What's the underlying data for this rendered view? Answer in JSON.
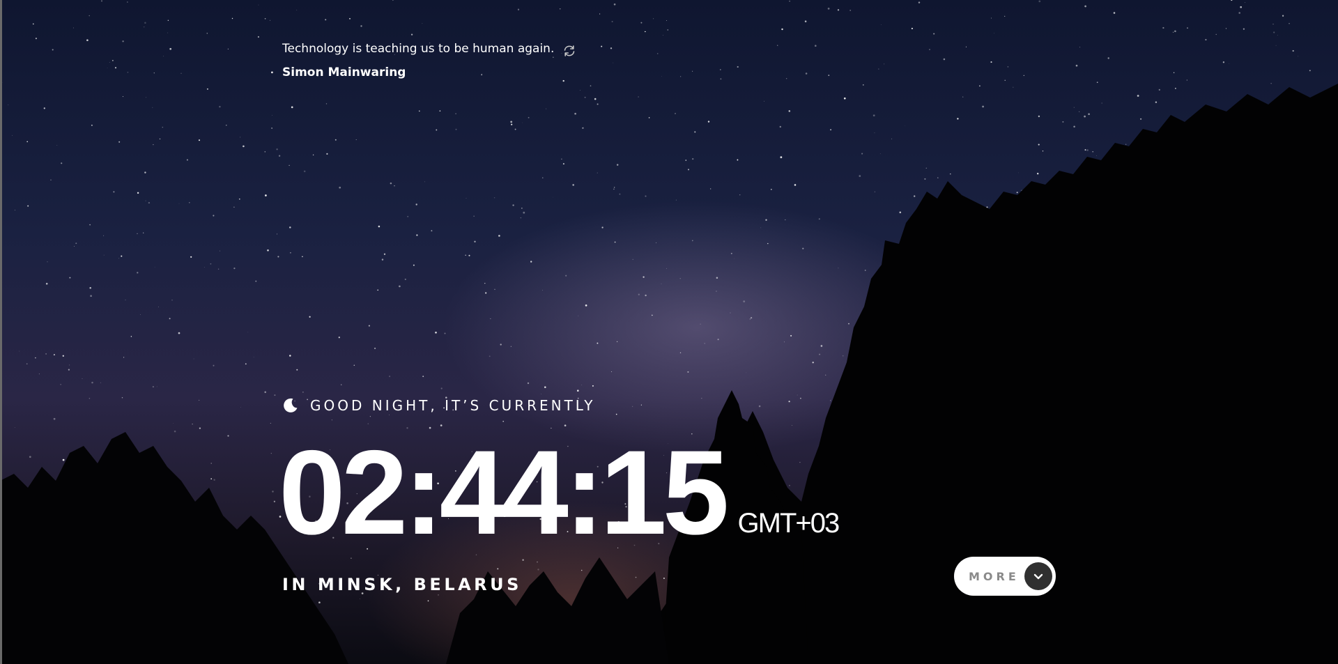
{
  "quote": {
    "text": "Technology is teaching us to be human again.",
    "author": "Simon Mainwaring"
  },
  "greeting": {
    "text": "GOOD NIGHT, IT’S CURRENTLY",
    "icon": "moon-icon"
  },
  "clock": {
    "time": "02:44:15",
    "timezone": "GMT+03"
  },
  "location": {
    "text": "IN MINSK, BELARUS"
  },
  "more_button": {
    "label": "MORE",
    "icon": "chevron-down-icon"
  },
  "colors": {
    "text": "#ffffff",
    "button_background": "#ffffff",
    "button_label": "#8a8a8a",
    "chevron_circle": "#303030"
  }
}
